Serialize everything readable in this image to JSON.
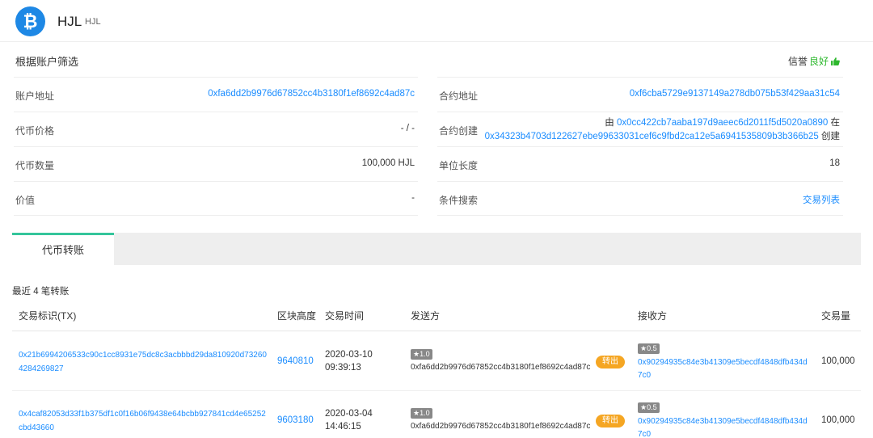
{
  "header": {
    "logo_glyph": "₿",
    "token_name": "HJL",
    "token_symbol": "HJL"
  },
  "info": {
    "filter_title": "根据账户筛选",
    "reputation_label": "信誉",
    "reputation_value": "良好",
    "left_rows": [
      {
        "label": "账户地址",
        "value": "0xfa6dd2b9976d67852cc4b3180f1ef8692c4ad87c"
      },
      {
        "label": "代币价格",
        "value": "- / -"
      },
      {
        "label": "代币数量",
        "value": "100,000 HJL"
      },
      {
        "label": "价值",
        "value": "-"
      }
    ],
    "contract_address_label": "合约地址",
    "contract_address": "0xf6cba5729e9137149a278db075b53f429aa31c54",
    "contract_created_label": "合约创建",
    "created_by_prefix": "由",
    "creator_address": "0x0cc422cb7aaba197d9aeec6d2011f5d5020a0890",
    "created_in": "在",
    "creation_tx": "0x34323b4703d122627ebe99633031cef6c9fbd2ca12e5a6941535809b3b366b25",
    "created_suffix": "创建",
    "unit_length_label": "单位长度",
    "unit_length_value": "18",
    "condition_search_label": "条件搜索",
    "condition_search_value": "交易列表"
  },
  "tabs": [
    {
      "label": "代币转账"
    }
  ],
  "transfers": {
    "recent_label": "最近 4 笔转账",
    "columns": [
      "交易标识(TX)",
      "区块高度",
      "交易时间",
      "发送方",
      "接收方",
      "交易量"
    ],
    "rows": [
      {
        "tx": "0x21b6994206533c90c1cc8931e75dc8c3acbbbd29da810920d732604284269827",
        "block": "9640810",
        "date": "2020-03-10",
        "time": "09:39:13",
        "from_badge": "★1.0",
        "from": "0xfa6dd2b9976d67852cc4b3180f1ef8692c4ad87c",
        "direction": "转出",
        "to_badge": "★0.5",
        "to": "0x90294935c84e3b41309e5becdf4848dfb434d7c0",
        "amount": "100,000"
      },
      {
        "tx": "0x4caf82053d33f1b375df1c0f16b06f9438e64bcbb927841cd4e65252cbd43660",
        "block": "9603180",
        "date": "2020-03-04",
        "time": "14:46:15",
        "from_badge": "★1.0",
        "from": "0xfa6dd2b9976d67852cc4b3180f1ef8692c4ad87c",
        "direction": "转出",
        "to_badge": "★0.5",
        "to": "0x90294935c84e3b41309e5becdf4848dfb434d7c0",
        "amount": "100,000"
      }
    ]
  }
}
